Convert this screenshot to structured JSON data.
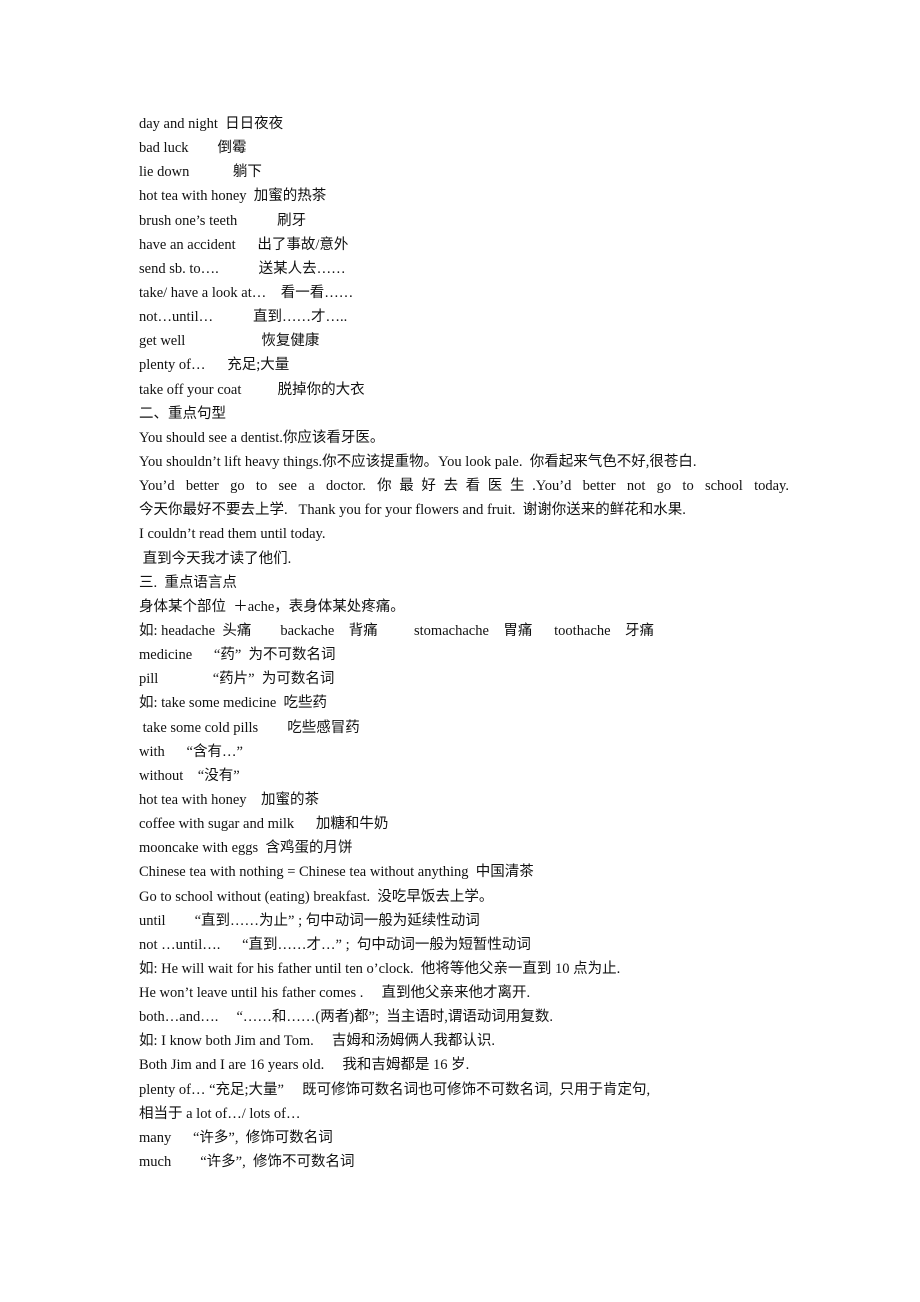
{
  "document": {
    "lines": [
      "day and night  日日夜夜",
      "bad luck        倒霉",
      "lie down            躺下",
      "hot tea with honey  加蜜的热茶",
      "brush one’s teeth           刷牙",
      "have an accident      出了事故/意外",
      "send sb. to….           送某人去……",
      "take/ have a look at…    看一看……",
      "not…until…           直到……才…..",
      "get well                     恢复健康",
      "plenty of…      充足;大量",
      "take off your coat          脱掉你的大衣",
      "二、重点句型",
      "You should see a dentist.你应该看牙医。",
      "You shouldn’t lift heavy things.你不应该提重物。You look pale.  你看起来气色不好,很苍白.",
      "You’d better go to see a doctor.    你最好去看医生.You’d better not go to school today.",
      "今天你最好不要去上学.   Thank you for your flowers and fruit.  谢谢你送来的鲜花和水果.",
      "I couldn’t read them until today.",
      " 直到今天我才读了他们.",
      "三.  重点语言点",
      "身体某个部位  ＋ache，表身体某处疼痛。",
      "如: headache  头痛        backache    背痛          stomachache    胃痛      toothache    牙痛",
      "medicine      “药”  为不可数名词",
      "pill               “药片”  为可数名词",
      "如: take some medicine  吃些药",
      " take some cold pills        吃些感冒药",
      "with      “含有…”",
      "without    “没有”",
      "hot tea with honey    加蜜的茶",
      "coffee with sugar and milk      加糖和牛奶",
      "mooncake with eggs  含鸡蛋的月饼",
      "Chinese tea with nothing = Chinese tea without anything  中国清茶",
      "Go to school without (eating) breakfast.  没吃早饭去上学。",
      "until        “直到……为止” ; 句中动词一般为延续性动词",
      "not …until….      “直到……才…” ;  句中动词一般为短暂性动词",
      "如: He will wait for his father until ten o’clock.  他将等他父亲一直到 10 点为止.",
      "He won’t leave until his father comes .     直到他父亲来他才离开.",
      "both…and….     “……和……(两者)都”;  当主语时,谓语动词用复数.",
      "如: I know both Jim and Tom.     吉姆和汤姆俩人我都认识.",
      "Both Jim and I are 16 years old.     我和吉姆都是 16 岁.",
      "plenty of… “充足;大量”     既可修饰可数名词也可修饰不可数名词,  只用于肯定句,",
      "相当于 a lot of…/ lots of…",
      "many      “许多”,  修饰可数名词",
      "much        “许多”,  修饰不可数名词"
    ]
  }
}
